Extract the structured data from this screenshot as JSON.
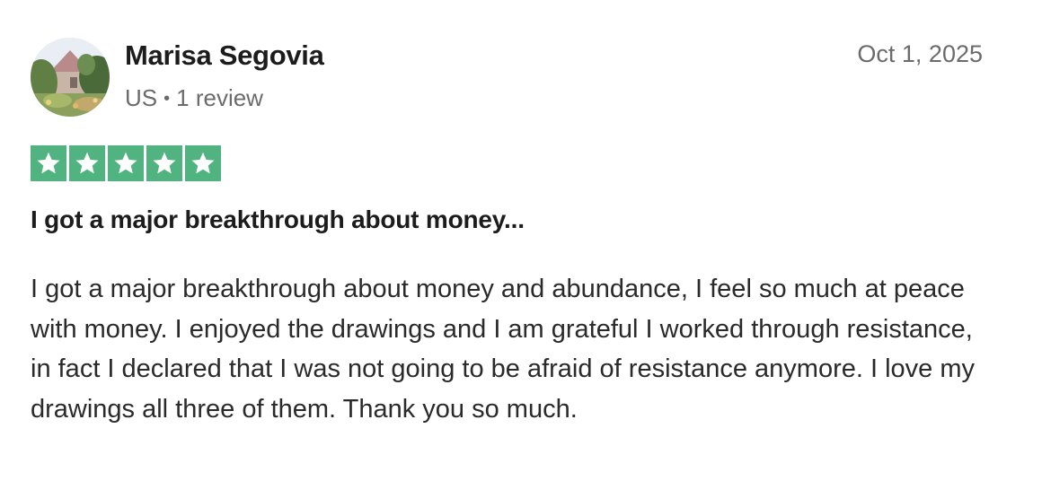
{
  "reviewer": {
    "name": "Marisa Segovia",
    "country": "US",
    "separator": "•",
    "review_count": "1 review"
  },
  "review": {
    "date": "Oct 1, 2025",
    "rating": 5,
    "rating_max": 5,
    "star_color": "#51b37f",
    "title": "I got a major breakthrough about money...",
    "body": "I got a major breakthrough about money and abundance, I feel so much at peace with money. I enjoyed the drawings and I am grateful I worked through resistance, in fact I declared that I was not going to be afraid of resistance anymore. I love my drawings all three of them. Thank you so much."
  }
}
